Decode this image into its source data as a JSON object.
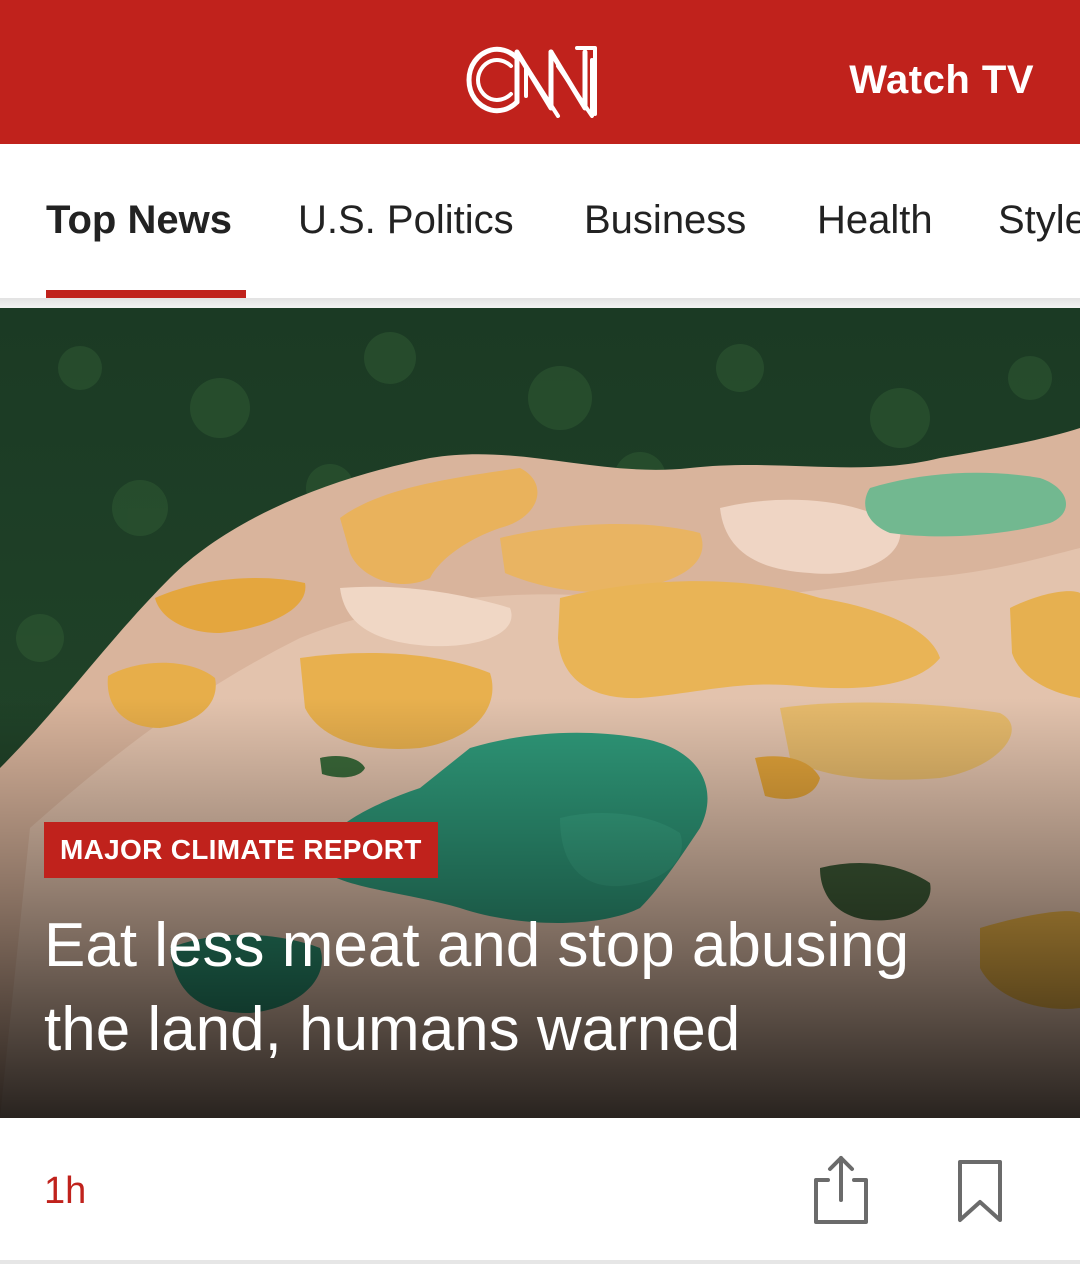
{
  "colors": {
    "brand_red": "#c0221c",
    "tab_text": "#222222",
    "white": "#ffffff"
  },
  "header": {
    "logo": "CNN",
    "watch_tv_label": "Watch TV"
  },
  "nav": {
    "tabs": [
      {
        "label": "Top News",
        "active": true
      },
      {
        "label": "U.S. Politics",
        "active": false
      },
      {
        "label": "Business",
        "active": false
      },
      {
        "label": "Health",
        "active": false
      },
      {
        "label": "Style",
        "active": false
      }
    ]
  },
  "article": {
    "badge": "MAJOR CLIMATE REPORT",
    "headline": "Eat less meat and stop abusing the land, humans warned",
    "time": "1h",
    "icons": [
      "share-icon",
      "bookmark-icon"
    ]
  }
}
